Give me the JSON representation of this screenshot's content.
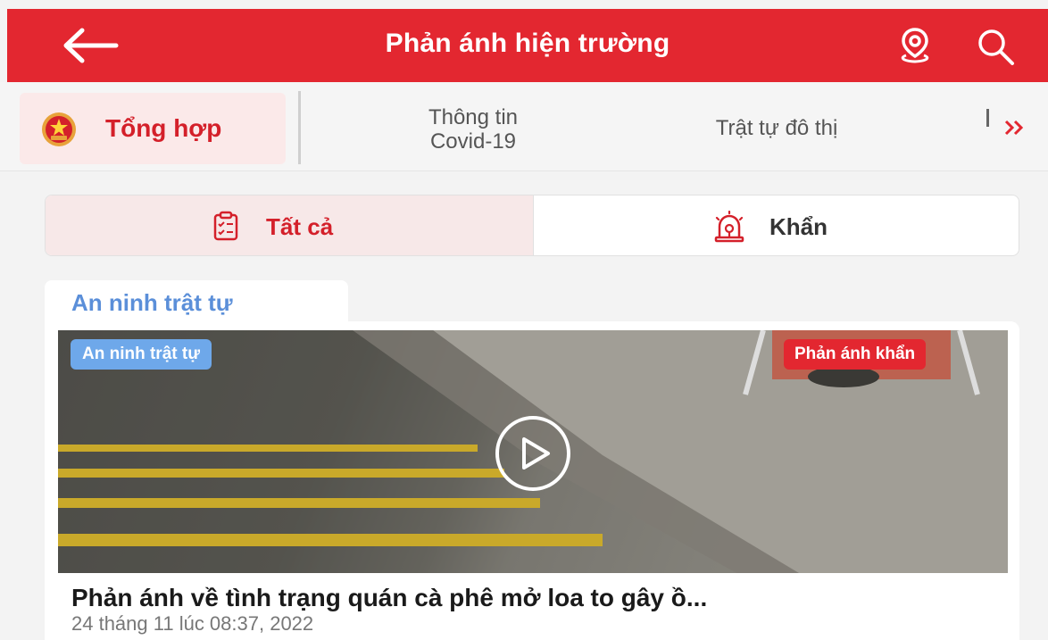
{
  "header": {
    "title": "Phản ánh hiện trường",
    "back_icon": "arrow-left-icon",
    "location_icon": "location-pin-icon",
    "search_icon": "search-icon",
    "bg_color": "#e32730"
  },
  "categories": {
    "active": {
      "label": "Tổng hợp",
      "icon": "emblem-icon"
    },
    "items": [
      {
        "label_line1": "Thông tin",
        "label_line2": "Covid-19"
      },
      {
        "label": "Trật tự đô thị"
      }
    ],
    "more_icon": "double-chevron-right-icon"
  },
  "filter": {
    "all_label": "Tất cả",
    "all_icon": "clipboard-list-icon",
    "urgent_label": "Khẩn",
    "urgent_icon": "siren-icon"
  },
  "section": {
    "label": "An ninh trật tự"
  },
  "post": {
    "category_badge": "An ninh trật tự",
    "urgent_badge": "Phản ánh khẩn",
    "title": "Phản ánh về tình trạng quán cà phê mở loa to gây ồ...",
    "date": "24 tháng 11 lúc 08:37, 2022",
    "media_icon": "play-icon"
  }
}
